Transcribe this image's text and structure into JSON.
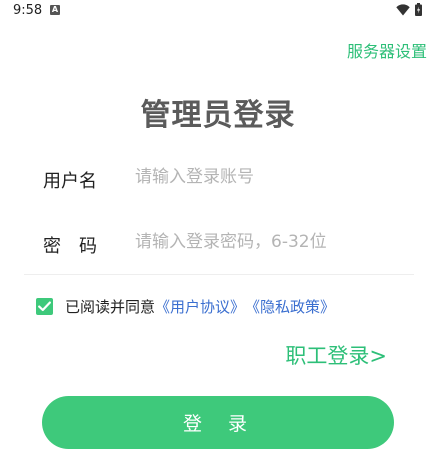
{
  "status_bar": {
    "time": "9:58",
    "notification_icon": "a-icon",
    "wifi_icon": "wifi-icon",
    "battery_icon": "battery-icon"
  },
  "header": {
    "server_settings": "服务器设置"
  },
  "title": "管理员登录",
  "form": {
    "username_label": "用户名",
    "username_placeholder": "请输入登录账号",
    "username_value": "",
    "password_label": "密码",
    "password_placeholder": "请输入登录密码，6-32位",
    "password_value": ""
  },
  "agreement": {
    "checked": true,
    "text": "已阅读并同意",
    "user_agreement": "《用户协议》",
    "privacy_policy": "《隐私政策》"
  },
  "staff_login": "职工登录>",
  "login_button": "登 录",
  "colors": {
    "accent": "#3ec97b",
    "link_green": "#2dbf78",
    "link_blue": "#3b6fd0",
    "title": "#5b5b5b"
  }
}
